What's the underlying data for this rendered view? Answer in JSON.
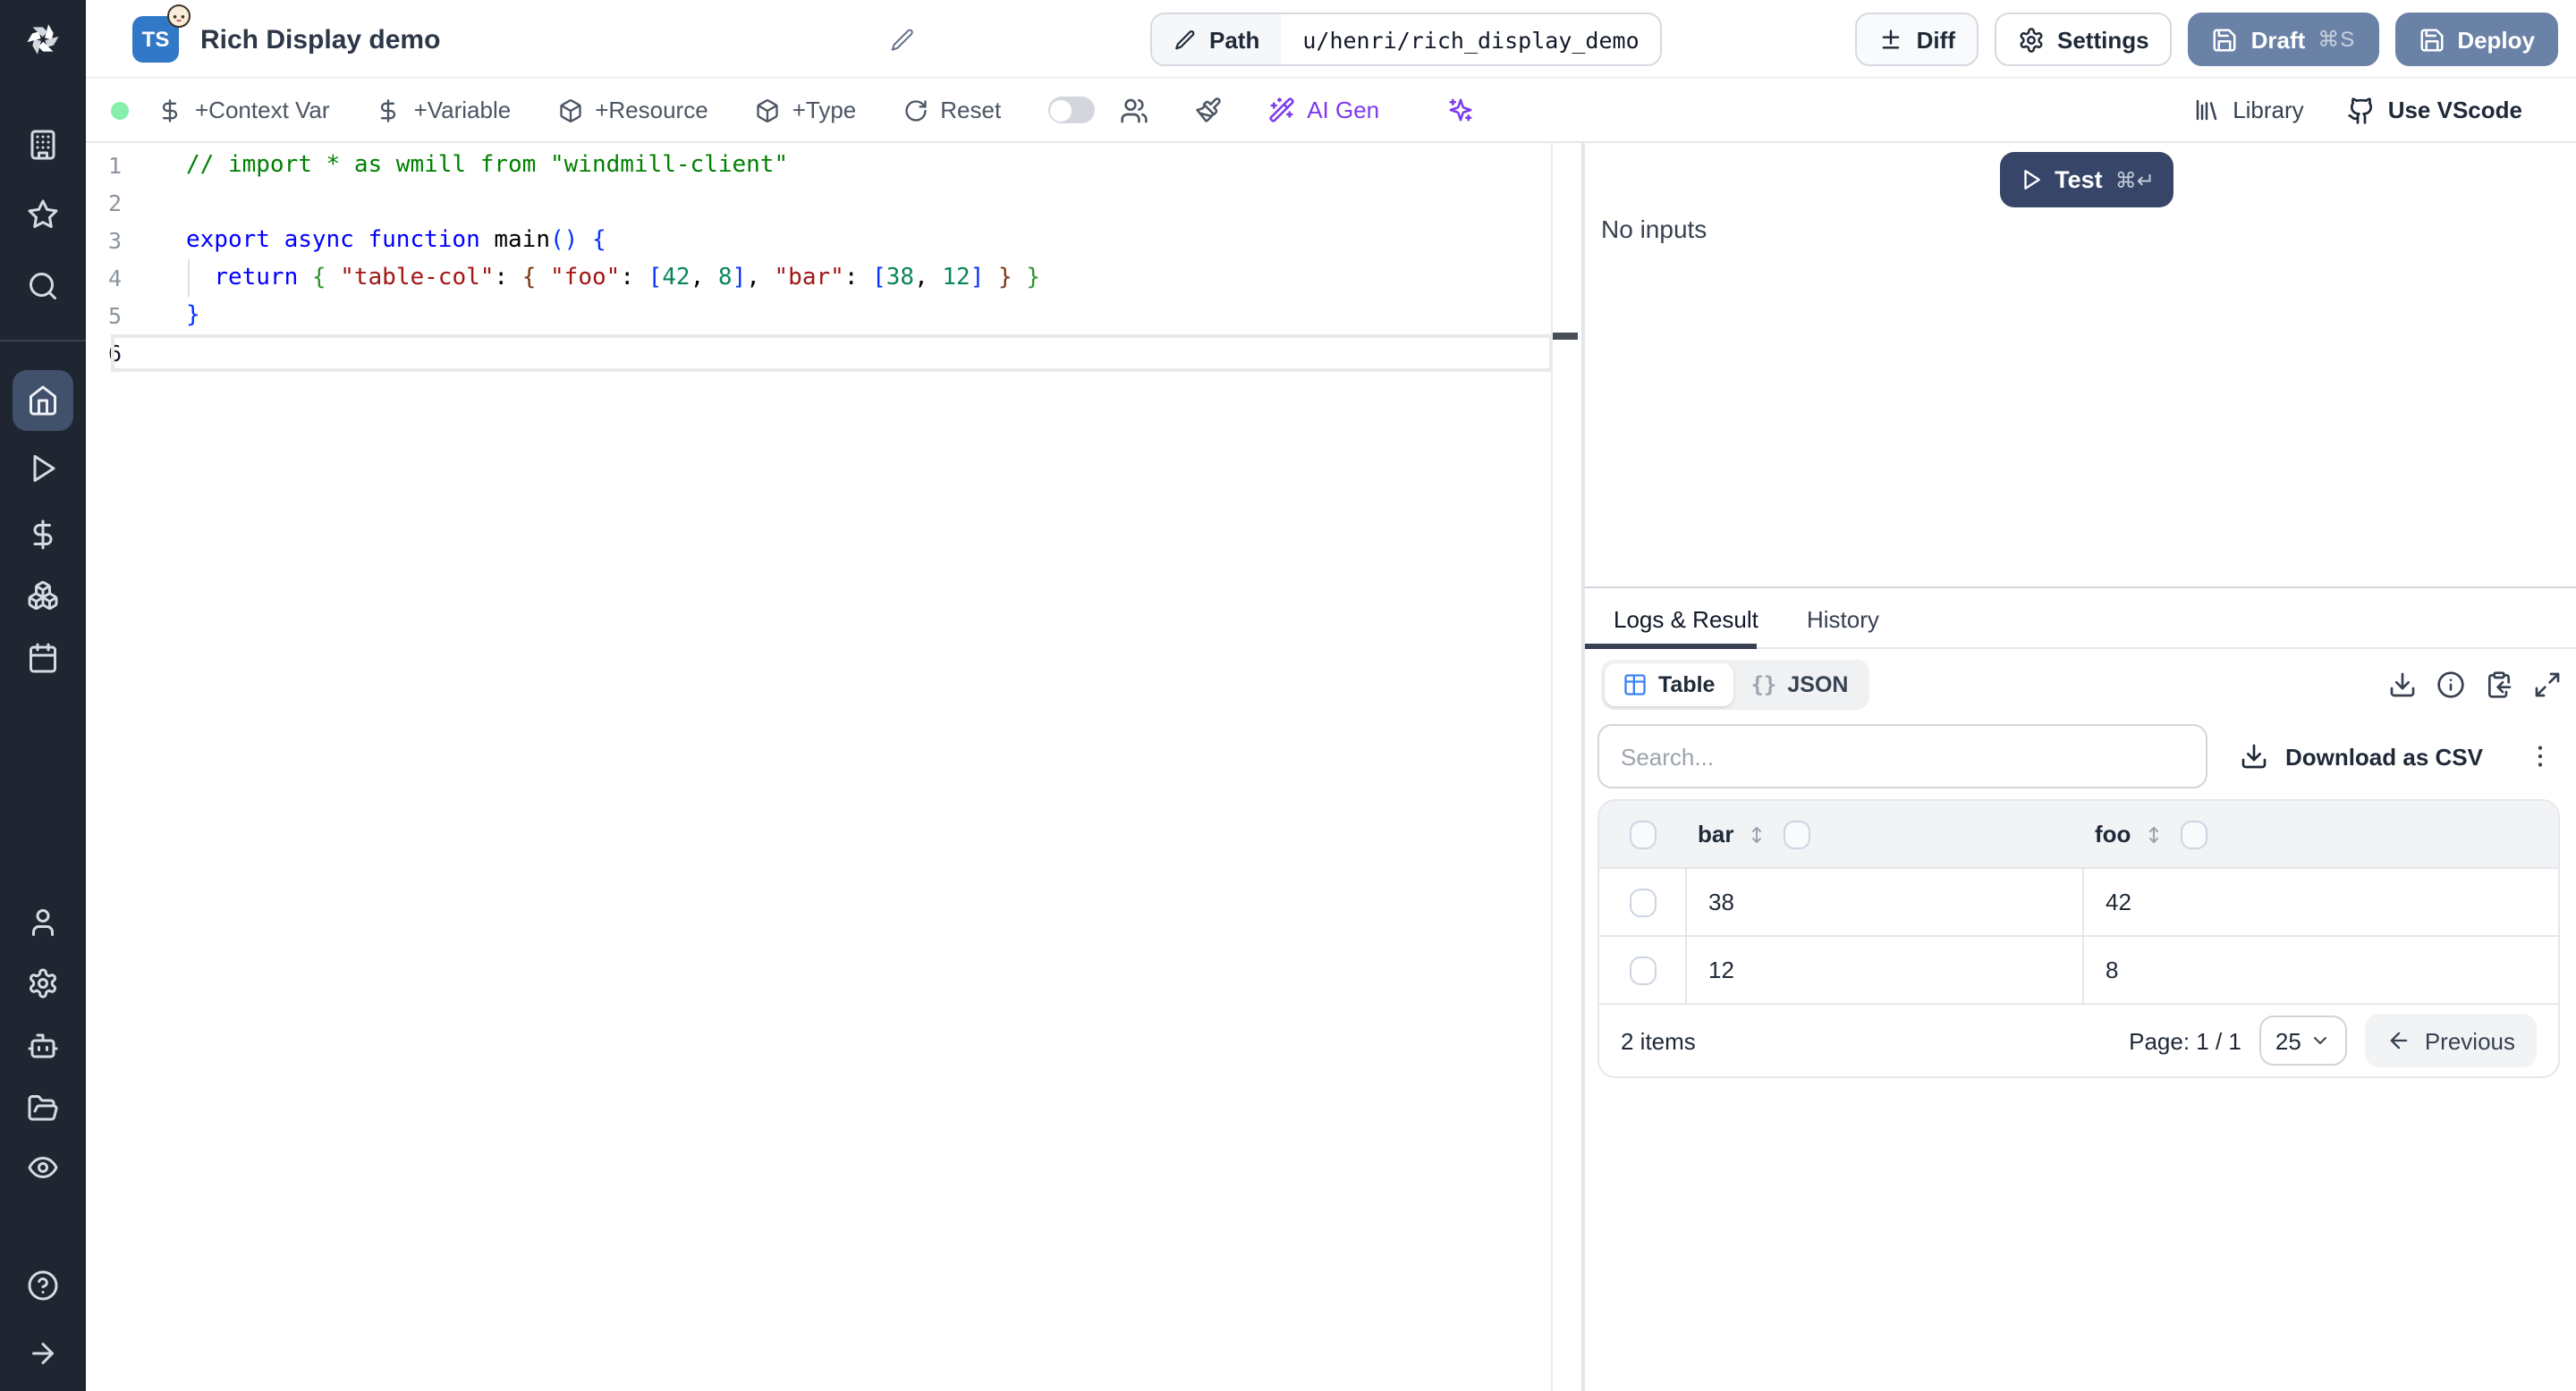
{
  "colors": {
    "sidebar_bg": "#1f2531",
    "sidebar_active": "#41506b",
    "sidebar_icon": "#d5dbe3",
    "accent_blue": "#3b82f6",
    "purple": "#7c3aed",
    "slate_btn": "#6b82a7",
    "navy_btn": "#374668",
    "ts_blue": "#3178c6",
    "green_dot": "#86efac",
    "border": "#e5e7eb",
    "text_dark": "#1f2937",
    "text_mid": "#4b5563",
    "text_light": "#9ca3af",
    "header_gray": "#f1f3f5",
    "underline": "#374151",
    "code_comment": "#008000",
    "code_kw": "#0000ff",
    "code_str": "#a31515",
    "code_num": "#098658",
    "code_b1": "#0431fa",
    "code_b2": "#319331",
    "code_b3": "#7b3814"
  },
  "header": {
    "title": "Rich Display demo",
    "lang_badge": "TS",
    "path_label": "Path",
    "path_value": "u/henri/rich_display_demo",
    "diff": "Diff",
    "settings": "Settings",
    "draft": "Draft",
    "draft_kbd": "⌘S",
    "deploy": "Deploy"
  },
  "toolbar": {
    "context_var": "+Context Var",
    "variable": "+Variable",
    "resource": "+Resource",
    "type": "+Type",
    "reset": "Reset",
    "ai_gen": "AI Gen",
    "library": "Library",
    "use_vscode": "Use VScode"
  },
  "editor": {
    "lines": [
      {
        "n": "1",
        "tokens": [
          [
            "comment",
            "// import * as wmill from \"windmill-client\""
          ]
        ]
      },
      {
        "n": "2",
        "tokens": []
      },
      {
        "n": "3",
        "tokens": [
          [
            "kw",
            "export async function "
          ],
          [
            "fn",
            "main"
          ],
          [
            "b1",
            "()"
          ],
          [
            "pl",
            " "
          ],
          [
            "b1",
            "{"
          ]
        ]
      },
      {
        "n": "4",
        "tokens": [
          [
            "pl",
            "  "
          ],
          [
            "kw",
            "return"
          ],
          [
            "pl",
            " "
          ],
          [
            "b2",
            "{"
          ],
          [
            "pl",
            " "
          ],
          [
            "str",
            "\"table-col\""
          ],
          [
            "pl",
            ": "
          ],
          [
            "b3",
            "{"
          ],
          [
            "pl",
            " "
          ],
          [
            "str",
            "\"foo\""
          ],
          [
            "pl",
            ": "
          ],
          [
            "b1",
            "["
          ],
          [
            "num",
            "42"
          ],
          [
            "pl",
            ", "
          ],
          [
            "num",
            "8"
          ],
          [
            "b1",
            "]"
          ],
          [
            "pl",
            ", "
          ],
          [
            "str",
            "\"bar\""
          ],
          [
            "pl",
            ": "
          ],
          [
            "b1",
            "["
          ],
          [
            "num",
            "38"
          ],
          [
            "pl",
            ", "
          ],
          [
            "num",
            "12"
          ],
          [
            "b1",
            "]"
          ],
          [
            "pl",
            " "
          ],
          [
            "b3",
            "}"
          ],
          [
            "pl",
            " "
          ],
          [
            "b2",
            "}"
          ]
        ]
      },
      {
        "n": "5",
        "tokens": [
          [
            "b1",
            "}"
          ]
        ]
      },
      {
        "n": "6",
        "tokens": [],
        "current": true
      }
    ]
  },
  "run": {
    "test": "Test",
    "test_kbd": "⌘↵",
    "no_inputs": "No inputs"
  },
  "result": {
    "tabs": [
      "Logs & Result",
      "History"
    ],
    "view_table": "Table",
    "json_glyph": "{}",
    "view_json": "JSON",
    "search_placeholder": "Search...",
    "download_csv": "Download as CSV",
    "table": {
      "columns": [
        "bar",
        "foo"
      ],
      "rows": [
        [
          "38",
          "42"
        ],
        [
          "12",
          "8"
        ]
      ]
    },
    "footer": {
      "items": "2 items",
      "page": "Page: 1 / 1",
      "page_size": "25",
      "previous": "Previous"
    }
  }
}
